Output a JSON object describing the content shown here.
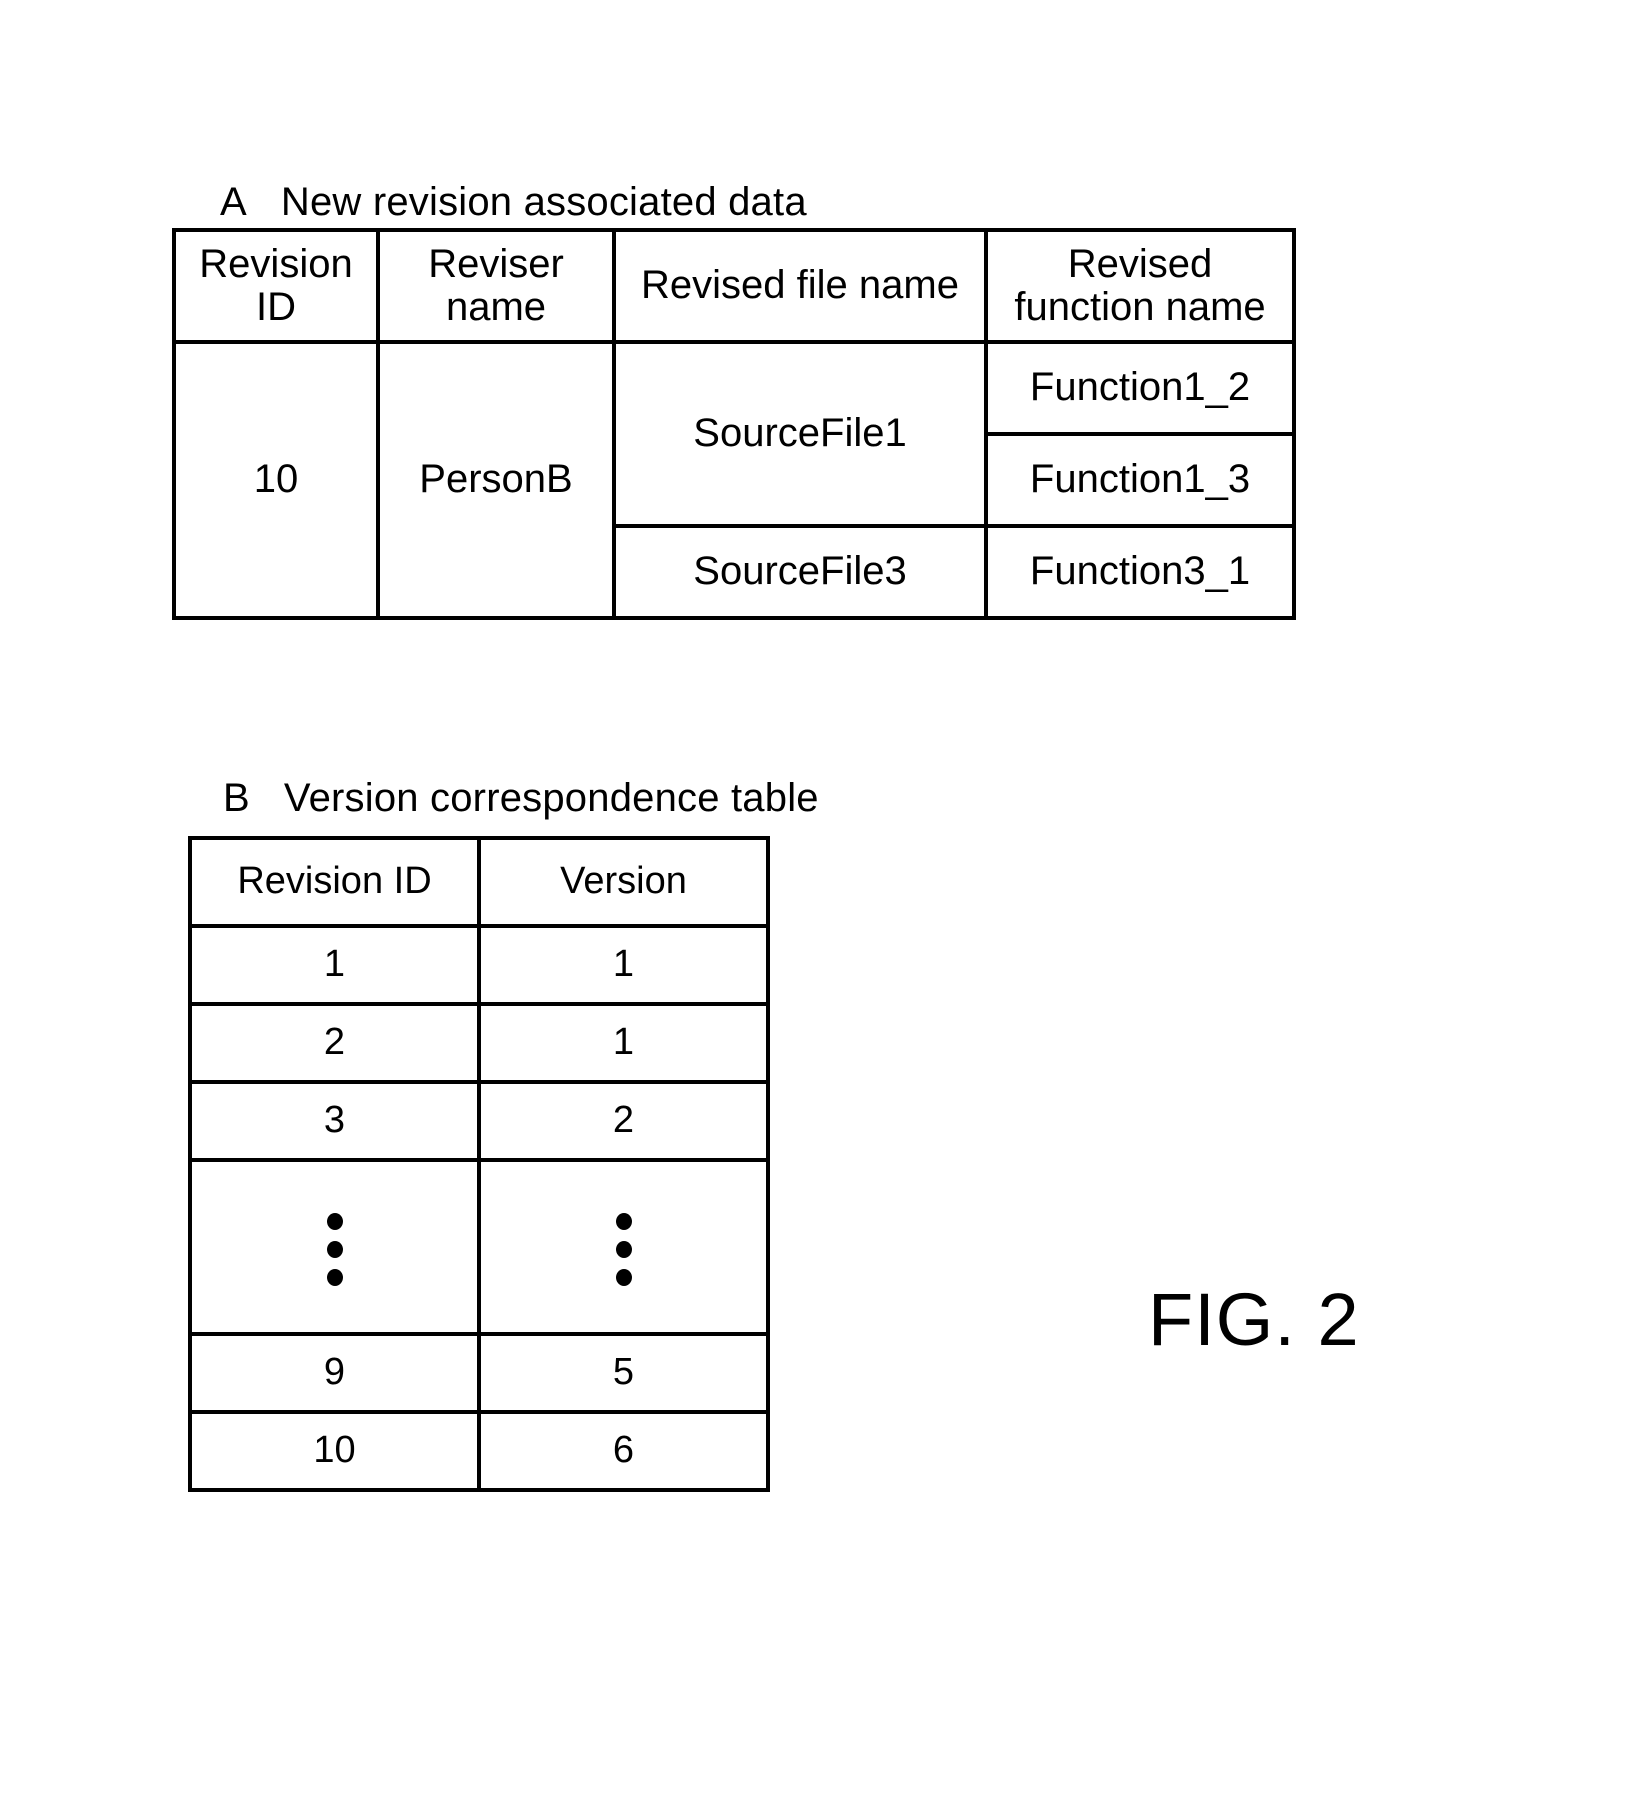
{
  "figure": {
    "label": "FIG. 2"
  },
  "section_a": {
    "letter": "A",
    "caption": "New revision associated data",
    "columns": [
      "Revision ID",
      "Reviser name",
      "Revised file name",
      "Revised function name"
    ],
    "columns_wrapped": [
      [
        "Revision",
        "ID"
      ],
      [
        "Reviser",
        "name"
      ],
      [
        "Revised file name"
      ],
      [
        "Revised",
        "function name"
      ]
    ],
    "revision_id": "10",
    "reviser_name": "PersonB",
    "files": [
      {
        "file_name": "SourceFile1",
        "functions": [
          "Function1_2",
          "Function1_3"
        ]
      },
      {
        "file_name": "SourceFile3",
        "functions": [
          "Function3_1"
        ]
      }
    ]
  },
  "section_b": {
    "letter": "B",
    "caption": "Version correspondence table",
    "columns": [
      "Revision ID",
      "Version"
    ],
    "rows": [
      {
        "revision_id": "1",
        "version": "1",
        "is_ellipsis": false
      },
      {
        "revision_id": "2",
        "version": "1",
        "is_ellipsis": false
      },
      {
        "revision_id": "3",
        "version": "2",
        "is_ellipsis": false
      },
      {
        "revision_id": "⋮",
        "version": "⋮",
        "is_ellipsis": true
      },
      {
        "revision_id": "9",
        "version": "5",
        "is_ellipsis": false
      },
      {
        "revision_id": "10",
        "version": "6",
        "is_ellipsis": false
      }
    ]
  }
}
